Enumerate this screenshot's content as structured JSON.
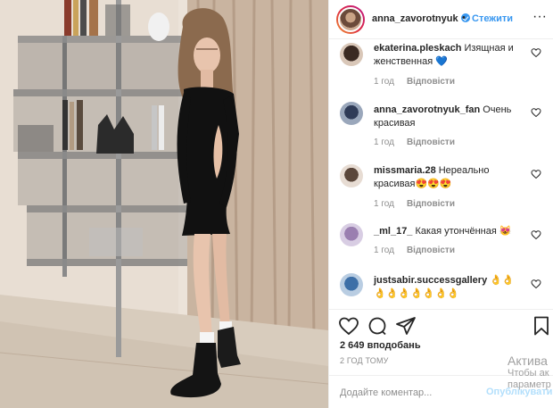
{
  "header": {
    "username": "anna_zavorotnyuk",
    "separator": "•",
    "follow_label": "Стежити",
    "more_label": "···"
  },
  "comments": [
    {
      "username": "ekaterina.pleskach",
      "text": "Изящная и женственная 💙",
      "time": "1 год",
      "reply": "Відповісти"
    },
    {
      "username": "anna_zavorotnyuk_fan",
      "text": "Очень красивая",
      "time": "1 год",
      "reply": "Відповісти"
    },
    {
      "username": "missmaria.28",
      "text": "Нереально красивая😍😍😍",
      "time": "1 год",
      "reply": "Відповісти"
    },
    {
      "username": "_ml_17_",
      "text": "Какая утончённая 😻",
      "time": "1 год",
      "reply": "Відповісти"
    },
    {
      "username": "justsabir.successgallery",
      "text": "👌👌👌👌👌👌👌👌👌",
      "time": "",
      "reply": ""
    }
  ],
  "actions": {
    "likes": "2 649 вподобань",
    "time": "2 ГОД ТОМУ"
  },
  "add_comment": {
    "placeholder": "Додайте коментар...",
    "publish_label": "Опублікувати"
  },
  "watermark": {
    "title": "Актива",
    "subtitle": "Чтобы ак параметр"
  },
  "colors": {
    "link": "#3897f0",
    "muted": "#8e8e8e",
    "text": "#262626"
  },
  "icons": [
    "heart-icon",
    "comment-icon",
    "share-icon",
    "bookmark-icon",
    "verified-badge-icon",
    "more-options-icon"
  ]
}
